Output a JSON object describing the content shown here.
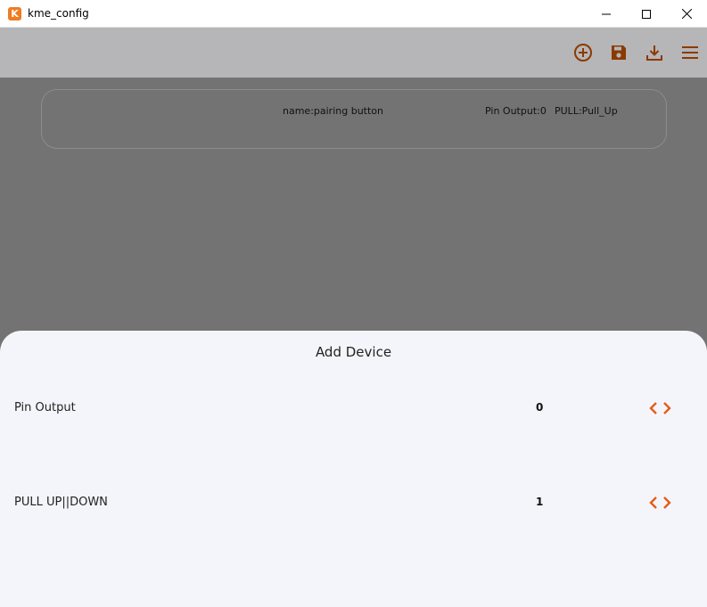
{
  "window": {
    "app_icon_letter": "K",
    "title": "kme_config"
  },
  "appbar": {
    "icons": [
      "add-circle-icon",
      "save-icon",
      "download-icon",
      "menu-icon"
    ],
    "icon_color": "#8a3a00"
  },
  "device_card": {
    "name": "name:pairing button",
    "pin_output": "Pin Output:0",
    "pull": "PULL:Pull_Up"
  },
  "sheet": {
    "title": "Add Device",
    "rows": [
      {
        "label": "Pin Output",
        "value": "0"
      },
      {
        "label": "PULL UP||DOWN",
        "value": "1"
      }
    ],
    "accent_color": "#e35d1a"
  }
}
